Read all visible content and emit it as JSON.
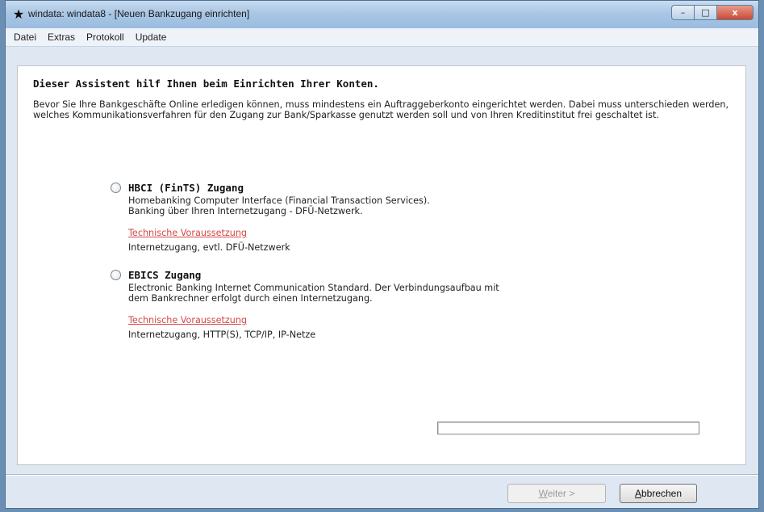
{
  "window": {
    "title": "windata: windata8 - [Neuen Bankzugang einrichten]",
    "controls": {
      "minimize": "–",
      "maximize": "□",
      "close": "x"
    }
  },
  "menu": [
    "Datei",
    "Extras",
    "Protokoll",
    "Update"
  ],
  "wizard": {
    "heading": "Dieser Assistent hilf Ihnen beim Einrichten Ihrer Konten.",
    "intro": "Bevor Sie Ihre Bankgeschäfte Online erledigen können, muss mindestens ein Auftraggeberkonto eingerichtet werden. Dabei muss unterschieden werden, welches Kommunikationsverfahren für den Zugang zur Bank/Sparkasse genutzt werden soll und von Ihren Kreditinstitut frei geschaltet ist.",
    "options": [
      {
        "title": "HBCI (FinTS) Zugang",
        "desc1": "Homebanking Computer Interface  (Financial Transaction Services).",
        "desc2": "Banking über Ihren Internetzugang - DFÜ-Netzwerk.",
        "link": "Technische Voraussetzung",
        "requirement": "Internetzugang, evtl. DFÜ-Netzwerk",
        "selected": false
      },
      {
        "title": "EBICS Zugang",
        "desc1": "Electronic Banking Internet Communication Standard. Der Verbindungsaufbau mit",
        "desc2": "dem Bankrechner erfolgt durch einen Internetzugang.",
        "link": "Technische Voraussetzung",
        "requirement": "Internetzugang, HTTP(S), TCP/IP, IP-Netze",
        "selected": false
      }
    ],
    "progress": 0
  },
  "buttons": {
    "next_mnemonic": "W",
    "next_rest": "eiter >",
    "cancel_mnemonic": "A",
    "cancel_rest": "bbrechen"
  }
}
